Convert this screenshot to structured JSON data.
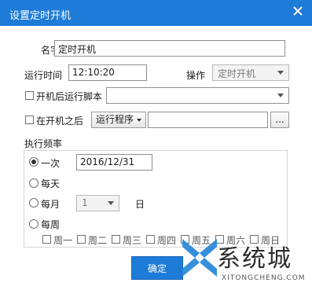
{
  "window": {
    "title": "设置定时开机"
  },
  "name_row": {
    "label": "名字",
    "value": "定时开机"
  },
  "time_row": {
    "label": "运行时间",
    "value": "12:10:20",
    "op_label": "操作",
    "op_value": "定时开机"
  },
  "script_row": {
    "checkbox_label": "开机后运行脚本",
    "value": ""
  },
  "after_row": {
    "checkbox_label": "在开机之后",
    "program_button": "运行程序",
    "path_value": "",
    "browse_button": "..."
  },
  "frequency": {
    "label": "执行频率",
    "once_label": "一次",
    "once_date": "2016/12/31",
    "daily_label": "每天",
    "monthly_label": "每月",
    "monthly_value": "1",
    "day_suffix": "日",
    "weekly_label": "每周",
    "selected": "once",
    "weekdays": [
      "周一",
      "周二",
      "周三",
      "周四",
      "周五",
      "周六",
      "周日"
    ]
  },
  "footer": {
    "ok_button": "确定"
  },
  "watermark": {
    "text": "系统城",
    "url": "XITONGCHENG.COM"
  },
  "colors": {
    "accent": "#1f7bd8",
    "title_text": "#ffffff"
  }
}
